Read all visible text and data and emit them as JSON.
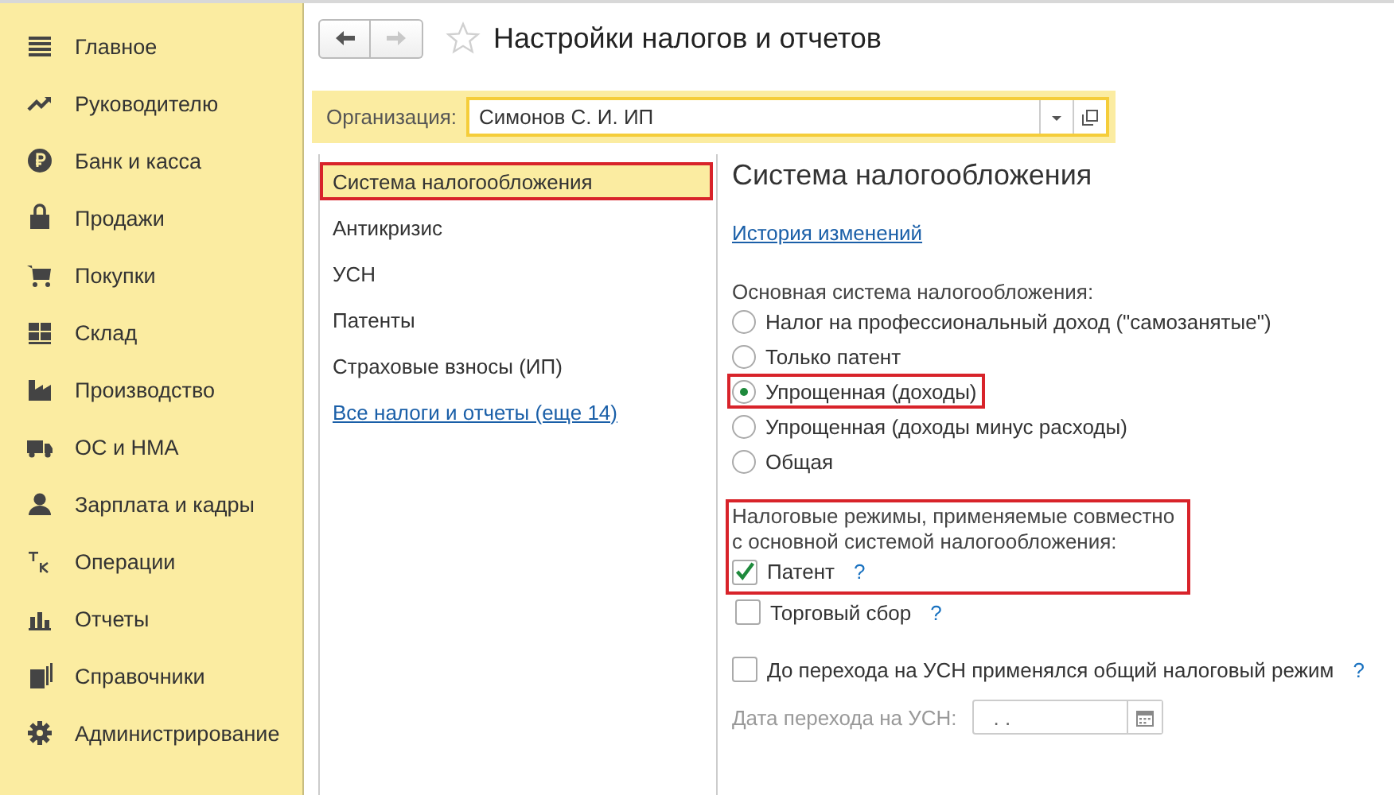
{
  "sidebar": {
    "items": [
      {
        "label": "Главное"
      },
      {
        "label": "Руководителю"
      },
      {
        "label": "Банк и касса"
      },
      {
        "label": "Продажи"
      },
      {
        "label": "Покупки"
      },
      {
        "label": "Склад"
      },
      {
        "label": "Производство"
      },
      {
        "label": "ОС и НМА"
      },
      {
        "label": "Зарплата и кадры"
      },
      {
        "label": "Операции"
      },
      {
        "label": "Отчеты"
      },
      {
        "label": "Справочники"
      },
      {
        "label": "Администрирование"
      }
    ]
  },
  "nav": [
    {
      "kind": "back",
      "disabled": false
    },
    {
      "kind": "forward",
      "disabled": true
    }
  ],
  "favorite": false,
  "title": "Настройки налогов и отчетов",
  "organization": {
    "label": "Организация:",
    "value": "Симонов С. И. ИП"
  },
  "sections": [
    {
      "kind": "item",
      "label": "Система налогообложения",
      "selected": true,
      "highlighted": true
    },
    {
      "kind": "item",
      "label": "Антикризис",
      "selected": false,
      "highlighted": false
    },
    {
      "kind": "item",
      "label": "УСН",
      "selected": false,
      "highlighted": false
    },
    {
      "kind": "item",
      "label": "Патенты",
      "selected": false,
      "highlighted": false
    },
    {
      "kind": "item",
      "label": "Страховые взносы (ИП)",
      "selected": false,
      "highlighted": false
    },
    {
      "kind": "link",
      "label": "Все налоги и отчеты (еще 14)",
      "selected": false,
      "highlighted": false
    }
  ],
  "content": {
    "heading": "Система налогообложения",
    "history_link": "История изменений",
    "tax_system": {
      "label": "Основная система налогообложения:",
      "options": [
        {
          "label": "Налог на профессиональный доход (\"самозанятые\")",
          "selected": false,
          "highlighted": false
        },
        {
          "label": "Только патент",
          "selected": false,
          "highlighted": false
        },
        {
          "label": "Упрощенная (доходы)",
          "selected": true,
          "highlighted": true
        },
        {
          "label": "Упрощенная (доходы минус расходы)",
          "selected": false,
          "highlighted": false
        },
        {
          "label": "Общая",
          "selected": false,
          "highlighted": false
        }
      ]
    },
    "combined": {
      "label": "Налоговые режимы, применяемые совместно\nс основной системой налогообложения:",
      "highlighted": true,
      "items": [
        {
          "label": "Патент",
          "checked": true,
          "help": "?"
        },
        {
          "label": "Торговый сбор",
          "checked": false,
          "help": "?"
        }
      ]
    },
    "previous_regime": {
      "label": "До перехода на УСН применялся общий налоговый режим",
      "checked": false,
      "help": "?"
    },
    "transition_date": {
      "label": "Дата перехода на УСН:",
      "value": ". .",
      "disabled": true
    }
  }
}
